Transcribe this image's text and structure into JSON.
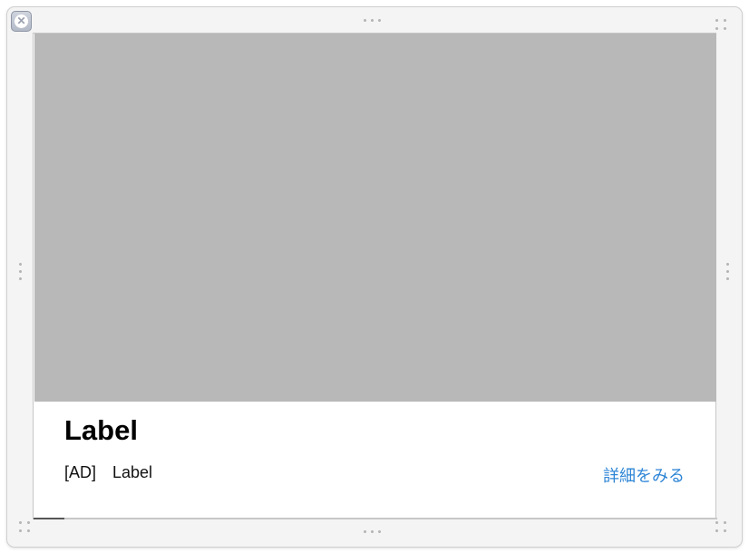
{
  "window": {
    "close_icon": "close-icon"
  },
  "ad_card": {
    "title": "Label",
    "ad_tag": "[AD]",
    "advertiser": "Label",
    "cta_label": "詳細をみる",
    "cta_color": "#2f86d6",
    "media_color": "#b8b8b8"
  }
}
